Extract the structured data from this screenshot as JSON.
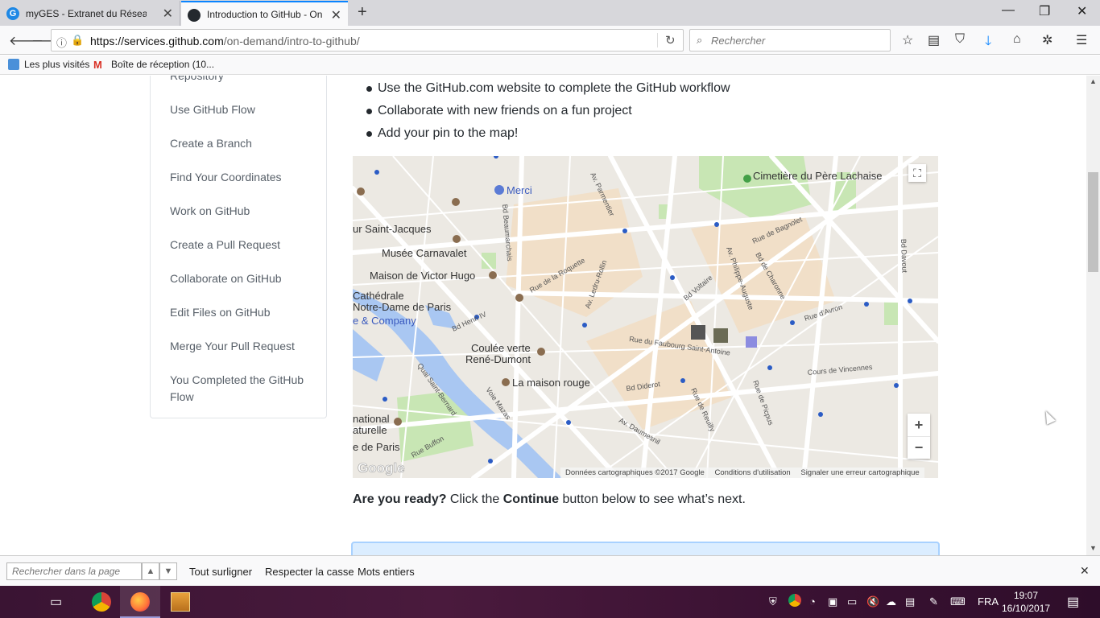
{
  "tabs": [
    {
      "label": "myGES - Extranet du Réseau",
      "active": false
    },
    {
      "label": "Introduction to GitHub - On",
      "active": true
    }
  ],
  "nav": {
    "url_host": "https://services.github.com",
    "url_path": "/on-demand/intro-to-github/",
    "search_placeholder": "Rechercher"
  },
  "bookmarks": [
    "Les plus visités",
    "Boîte de réception (10..."
  ],
  "sidebar": {
    "items": [
      "Repository",
      "Use GitHub Flow",
      "Create a Branch",
      "Find Your Coordinates",
      "Work on GitHub",
      "Create a Pull Request",
      "Collaborate on GitHub",
      "Edit Files on GitHub",
      "Merge Your Pull Request",
      "You Completed the GitHub Flow"
    ]
  },
  "content": {
    "bullets": [
      "Use the GitHub.com website to complete the GitHub workflow",
      "Collaborate with new friends on a fun project",
      "Add your pin to the map!"
    ],
    "ready_bold": "Are you ready?",
    "ready_mid": " Click the ",
    "ready_button": "Continue",
    "ready_end": " button below to see what’s next."
  },
  "map": {
    "labels": {
      "cemetery": "Cimetière du Père Lachaise",
      "merci": "Merci",
      "st_jacques": "ur Saint-Jacques",
      "carnavalet": "Musée Carnavalet",
      "victor_hugo": "Maison de Victor Hugo",
      "cathedrale1": "Cathédrale",
      "cathedrale2": "Notre-Dame de Paris",
      "company": "e & Company",
      "coulee1": "Coulée verte",
      "coulee2": "René-Dumont",
      "maison_rouge": "La maison rouge",
      "national": "national",
      "naturelle": "aturelle",
      "de_paris": "e de Paris",
      "faubourg": "Rue du Faubourg Saint-Antoine",
      "voltaire": "Bd Voltaire",
      "diderot": "Bd Diderot",
      "vincennes": "Cours de Vincennes",
      "roquette": "Rue de la Roquette",
      "bagnolet": "Rue de Bagnolet",
      "charonne": "Bd de Charonne",
      "ledru": "Av. Ledru-Rollin",
      "henri": "Bd Henri IV",
      "beaumarchais": "Bd Beaumarchais",
      "davout": "Bd Davout",
      "avron": "Rue d'Avron",
      "parmentier": "Av. Parmentier",
      "philippe": "Av. Philippe-Auguste",
      "reuilly": "Rue de Reuilly",
      "picpus": "Rue de Picpus",
      "quai_bernard": "Quai Saint-Bernard",
      "buffon": "Rue Buffon",
      "daumesnil": "Av. Daumesnil",
      "mazas": "Voie Mazas"
    },
    "footer_data": "Données cartographiques ©2017 Google",
    "footer_terms": "Conditions d'utilisation",
    "footer_report": "Signaler une erreur cartographique",
    "google": "Google",
    "zoom_in": "+",
    "zoom_out": "−"
  },
  "findbar": {
    "placeholder": "Rechercher dans la page",
    "highlight_all": "Tout surligner",
    "match_case": "Respecter la casse",
    "whole_words": "Mots entiers"
  },
  "taskbar": {
    "language": "FRA",
    "time": "19:07",
    "date": "16/10/2017"
  },
  "colors": {
    "accent": "#0a84ff",
    "taskbar": "#3a1433",
    "map_water": "#a9c7f2",
    "map_park": "#c8e6b4"
  }
}
